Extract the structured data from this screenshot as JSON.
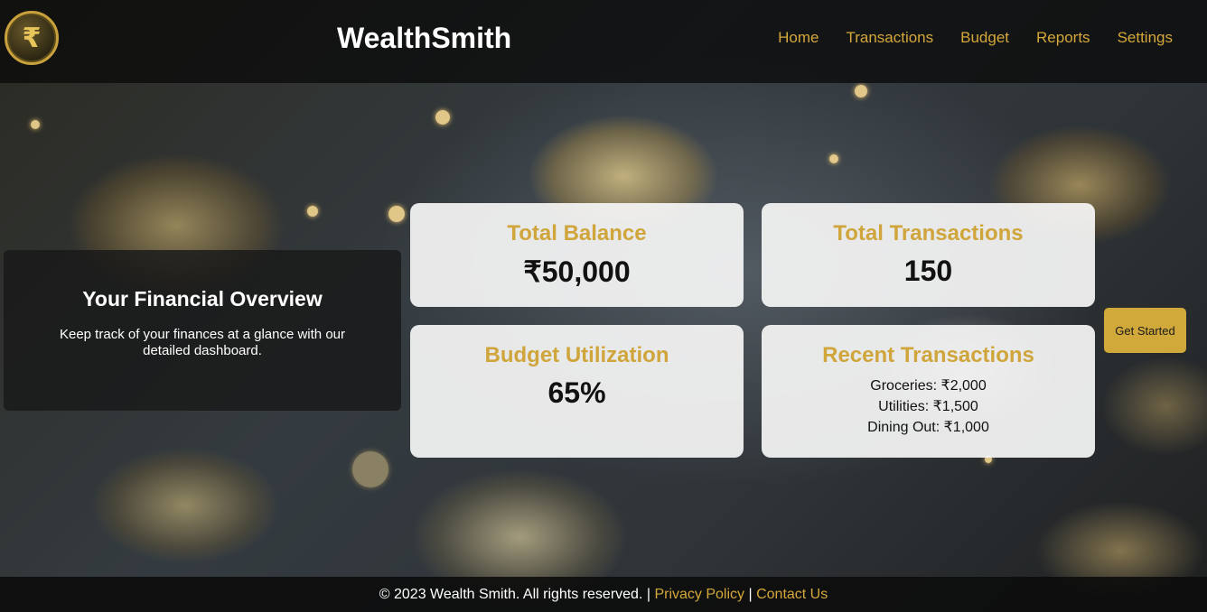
{
  "header": {
    "logo_symbol": "₹",
    "brand": "WealthSmith",
    "nav": [
      "Home",
      "Transactions",
      "Budget",
      "Reports",
      "Settings"
    ]
  },
  "overview": {
    "title": "Your Financial Overview",
    "text": "Keep track of your finances at a glance with our detailed dashboard."
  },
  "cards": {
    "balance": {
      "title": "Total Balance",
      "value": "₹50,000"
    },
    "transactions": {
      "title": "Total Transactions",
      "value": "150"
    },
    "budget": {
      "title": "Budget Utilization",
      "value": "65%"
    },
    "recent": {
      "title": "Recent Transactions",
      "items": [
        "Groceries: ₹2,000",
        "Utilities: ₹1,500",
        "Dining Out: ₹1,000"
      ]
    }
  },
  "cta": {
    "label": "Get Started"
  },
  "footer": {
    "copyright": "© 2023 Wealth Smith. All rights reserved.",
    "separator": "|",
    "privacy": "Privacy Policy",
    "contact": "Contact Us"
  },
  "colors": {
    "accent": "#d4a83a",
    "card_bg": "#f5f5f5",
    "header_bg": "#0a0a0a"
  }
}
